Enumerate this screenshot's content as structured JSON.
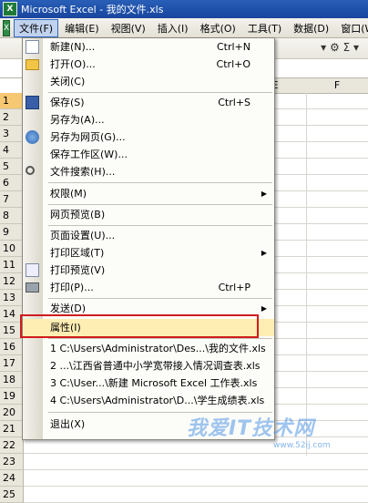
{
  "window": {
    "title": "Microsoft Excel - 我的文件.xls",
    "app_icon": "X"
  },
  "menubar": {
    "items": [
      "文件(F)",
      "编辑(E)",
      "视图(V)",
      "插入(I)",
      "格式(O)",
      "工具(T)",
      "数据(D)",
      "窗口(W)"
    ]
  },
  "toolbar": {
    "right_glyphs": "▾ ⚙ Σ ▾"
  },
  "grid": {
    "columns": [
      "E",
      "F"
    ],
    "rows": [
      "1",
      "2",
      "3",
      "4",
      "5",
      "6",
      "7",
      "8",
      "9",
      "10",
      "11",
      "12",
      "13",
      "14",
      "15",
      "16",
      "17",
      "18",
      "19",
      "20",
      "21",
      "22",
      "23",
      "24",
      "25"
    ]
  },
  "file_menu": {
    "new": {
      "label": "新建(N)...",
      "shortcut": "Ctrl+N"
    },
    "open": {
      "label": "打开(O)...",
      "shortcut": "Ctrl+O"
    },
    "close": {
      "label": "关闭(C)"
    },
    "save": {
      "label": "保存(S)",
      "shortcut": "Ctrl+S"
    },
    "save_as": {
      "label": "另存为(A)..."
    },
    "save_as_web": {
      "label": "另存为网页(G)..."
    },
    "save_workspace": {
      "label": "保存工作区(W)..."
    },
    "file_search": {
      "label": "文件搜索(H)..."
    },
    "permission": {
      "label": "权限(M)"
    },
    "web_preview": {
      "label": "网页预览(B)"
    },
    "page_setup": {
      "label": "页面设置(U)..."
    },
    "print_area": {
      "label": "打印区域(T)"
    },
    "print_preview": {
      "label": "打印预览(V)"
    },
    "print": {
      "label": "打印(P)...",
      "shortcut": "Ctrl+P"
    },
    "send_to": {
      "label": "发送(D)"
    },
    "properties": {
      "label": "属性(I)"
    },
    "recent": [
      "1 C:\\Users\\Administrator\\Des...\\我的文件.xls",
      "2 ...\\江西省普通中小学宽带接入情况调查表.xls",
      "3 C:\\User...\\新建 Microsoft Excel 工作表.xls",
      "4 C:\\Users\\Administrator\\D...\\学生成绩表.xls"
    ],
    "exit": {
      "label": "退出(X)"
    }
  },
  "watermark": {
    "text": "我爱IT技术网",
    "url": "www.52ij.com"
  }
}
